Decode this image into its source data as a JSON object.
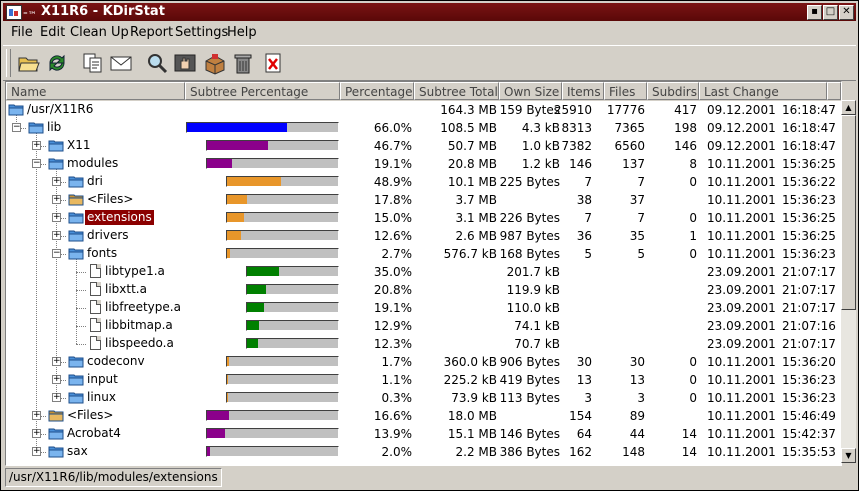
{
  "window": {
    "title": "X11R6 - KDirStat",
    "buttons": [
      "▪",
      "□",
      "✕"
    ]
  },
  "menu": [
    "File",
    "Edit",
    "Clean Up",
    "Report",
    "Settings",
    "Help"
  ],
  "toolbar": [
    "open-folder-icon",
    "refresh-icon",
    "copy-icon",
    "mail-icon",
    "find-icon",
    "hand-icon",
    "package-icon",
    "trash-icon",
    "delete-icon"
  ],
  "columns": [
    "Name",
    "Subtree Percentage",
    "Percentage",
    "Subtree Total",
    "Own Size",
    "Items",
    "Files",
    "Subdirs",
    "Last Change"
  ],
  "rows": [
    {
      "depth": 0,
      "expander": "",
      "icon": "folder",
      "name": "/usr/X11R6",
      "bar": null,
      "pct": "",
      "total": "164.3 MB",
      "own": "159 Bytes",
      "items": "25910",
      "files": "17776",
      "subdirs": "417",
      "date": "09.12.2001",
      "time": "16:18:47"
    },
    {
      "depth": 1,
      "expander": "−",
      "icon": "folder",
      "name": "lib",
      "bar": {
        "level": 0,
        "fraction": 0.66,
        "color": "#0000ff"
      },
      "pct": "66.0%",
      "total": "108.5 MB",
      "own": "4.3 kB",
      "items": "8313",
      "files": "7365",
      "subdirs": "198",
      "date": "09.12.2001",
      "time": "16:18:47"
    },
    {
      "depth": 2,
      "expander": "+",
      "icon": "folder",
      "name": "X11",
      "bar": {
        "level": 1,
        "fraction": 0.467,
        "color": "#8b008b"
      },
      "pct": "46.7%",
      "total": "50.7 MB",
      "own": "1.0 kB",
      "items": "7382",
      "files": "6560",
      "subdirs": "146",
      "date": "09.12.2001",
      "time": "16:18:47"
    },
    {
      "depth": 2,
      "expander": "−",
      "icon": "folder",
      "name": "modules",
      "bar": {
        "level": 1,
        "fraction": 0.191,
        "color": "#8b008b"
      },
      "pct": "19.1%",
      "total": "20.8 MB",
      "own": "1.2 kB",
      "items": "146",
      "files": "137",
      "subdirs": "8",
      "date": "10.11.2001",
      "time": "15:36:25"
    },
    {
      "depth": 3,
      "expander": "+",
      "icon": "folder",
      "name": "dri",
      "bar": {
        "level": 2,
        "fraction": 0.489,
        "color": "#e8962a"
      },
      "pct": "48.9%",
      "total": "10.1 MB",
      "own": "225 Bytes",
      "items": "7",
      "files": "7",
      "subdirs": "0",
      "date": "10.11.2001",
      "time": "15:36:22"
    },
    {
      "depth": 3,
      "expander": "+",
      "icon": "files",
      "name": "<Files>",
      "bar": {
        "level": 2,
        "fraction": 0.178,
        "color": "#e8962a"
      },
      "pct": "17.8%",
      "total": "3.7 MB",
      "own": "",
      "items": "38",
      "files": "37",
      "subdirs": "",
      "date": "10.11.2001",
      "time": "15:36:23"
    },
    {
      "depth": 3,
      "expander": "+",
      "icon": "folder",
      "name": "extensions",
      "selected": true,
      "bar": {
        "level": 2,
        "fraction": 0.15,
        "color": "#e8962a"
      },
      "pct": "15.0%",
      "total": "3.1 MB",
      "own": "226 Bytes",
      "items": "7",
      "files": "7",
      "subdirs": "0",
      "date": "10.11.2001",
      "time": "15:36:25"
    },
    {
      "depth": 3,
      "expander": "+",
      "icon": "folder",
      "name": "drivers",
      "bar": {
        "level": 2,
        "fraction": 0.126,
        "color": "#e8962a"
      },
      "pct": "12.6%",
      "total": "2.6 MB",
      "own": "987 Bytes",
      "items": "36",
      "files": "35",
      "subdirs": "1",
      "date": "10.11.2001",
      "time": "15:36:25"
    },
    {
      "depth": 3,
      "expander": "−",
      "icon": "folder",
      "name": "fonts",
      "bar": {
        "level": 2,
        "fraction": 0.027,
        "color": "#e8962a"
      },
      "pct": "2.7%",
      "total": "576.7 kB",
      "own": "168 Bytes",
      "items": "5",
      "files": "5",
      "subdirs": "0",
      "date": "10.11.2001",
      "time": "15:36:23"
    },
    {
      "depth": 4,
      "expander": "",
      "icon": "file",
      "name": "libtype1.a",
      "bar": {
        "level": 3,
        "fraction": 0.35,
        "color": "#008000"
      },
      "pct": "35.0%",
      "total": "",
      "own": "201.7 kB",
      "items": "",
      "files": "",
      "subdirs": "",
      "date": "23.09.2001",
      "time": "21:07:17"
    },
    {
      "depth": 4,
      "expander": "",
      "icon": "file",
      "name": "libxtt.a",
      "bar": {
        "level": 3,
        "fraction": 0.208,
        "color": "#008000"
      },
      "pct": "20.8%",
      "total": "",
      "own": "119.9 kB",
      "items": "",
      "files": "",
      "subdirs": "",
      "date": "23.09.2001",
      "time": "21:07:17"
    },
    {
      "depth": 4,
      "expander": "",
      "icon": "file",
      "name": "libfreetype.a",
      "bar": {
        "level": 3,
        "fraction": 0.191,
        "color": "#008000"
      },
      "pct": "19.1%",
      "total": "",
      "own": "110.0 kB",
      "items": "",
      "files": "",
      "subdirs": "",
      "date": "23.09.2001",
      "time": "21:07:17"
    },
    {
      "depth": 4,
      "expander": "",
      "icon": "file",
      "name": "libbitmap.a",
      "bar": {
        "level": 3,
        "fraction": 0.129,
        "color": "#008000"
      },
      "pct": "12.9%",
      "total": "",
      "own": "74.1 kB",
      "items": "",
      "files": "",
      "subdirs": "",
      "date": "23.09.2001",
      "time": "21:07:16"
    },
    {
      "depth": 4,
      "expander": "",
      "icon": "file",
      "name": "libspeedo.a",
      "bar": {
        "level": 3,
        "fraction": 0.123,
        "color": "#008000"
      },
      "pct": "12.3%",
      "total": "",
      "own": "70.7 kB",
      "items": "",
      "files": "",
      "subdirs": "",
      "date": "23.09.2001",
      "time": "21:07:17"
    },
    {
      "depth": 3,
      "expander": "+",
      "icon": "folder",
      "name": "codeconv",
      "bar": {
        "level": 2,
        "fraction": 0.017,
        "color": "#e8962a"
      },
      "pct": "1.7%",
      "total": "360.0 kB",
      "own": "906 Bytes",
      "items": "30",
      "files": "30",
      "subdirs": "0",
      "date": "10.11.2001",
      "time": "15:36:20"
    },
    {
      "depth": 3,
      "expander": "+",
      "icon": "folder",
      "name": "input",
      "bar": {
        "level": 2,
        "fraction": 0.011,
        "color": "#e8962a"
      },
      "pct": "1.1%",
      "total": "225.2 kB",
      "own": "419 Bytes",
      "items": "13",
      "files": "13",
      "subdirs": "0",
      "date": "10.11.2001",
      "time": "15:36:23"
    },
    {
      "depth": 3,
      "expander": "+",
      "icon": "folder",
      "name": "linux",
      "bar": {
        "level": 2,
        "fraction": 0.003,
        "color": "#e8962a"
      },
      "pct": "0.3%",
      "total": "73.9 kB",
      "own": "113 Bytes",
      "items": "3",
      "files": "3",
      "subdirs": "0",
      "date": "10.11.2001",
      "time": "15:36:23"
    },
    {
      "depth": 2,
      "expander": "+",
      "icon": "files",
      "name": "<Files>",
      "bar": {
        "level": 1,
        "fraction": 0.166,
        "color": "#8b008b"
      },
      "pct": "16.6%",
      "total": "18.0 MB",
      "own": "",
      "items": "154",
      "files": "89",
      "subdirs": "",
      "date": "10.11.2001",
      "time": "15:46:49"
    },
    {
      "depth": 2,
      "expander": "+",
      "icon": "folder",
      "name": "Acrobat4",
      "bar": {
        "level": 1,
        "fraction": 0.139,
        "color": "#8b008b"
      },
      "pct": "13.9%",
      "total": "15.1 MB",
      "own": "146 Bytes",
      "items": "64",
      "files": "44",
      "subdirs": "14",
      "date": "10.11.2001",
      "time": "15:42:37"
    },
    {
      "depth": 2,
      "expander": "+",
      "icon": "folder",
      "name": "sax",
      "bar": {
        "level": 1,
        "fraction": 0.02,
        "color": "#8b008b"
      },
      "pct": "2.0%",
      "total": "2.2 MB",
      "own": "386 Bytes",
      "items": "162",
      "files": "148",
      "subdirs": "14",
      "date": "10.11.2001",
      "time": "15:35:53"
    }
  ],
  "status": "/usr/X11R6/lib/modules/extensions",
  "scrollbar": {
    "up": "▲",
    "down": "▼"
  }
}
